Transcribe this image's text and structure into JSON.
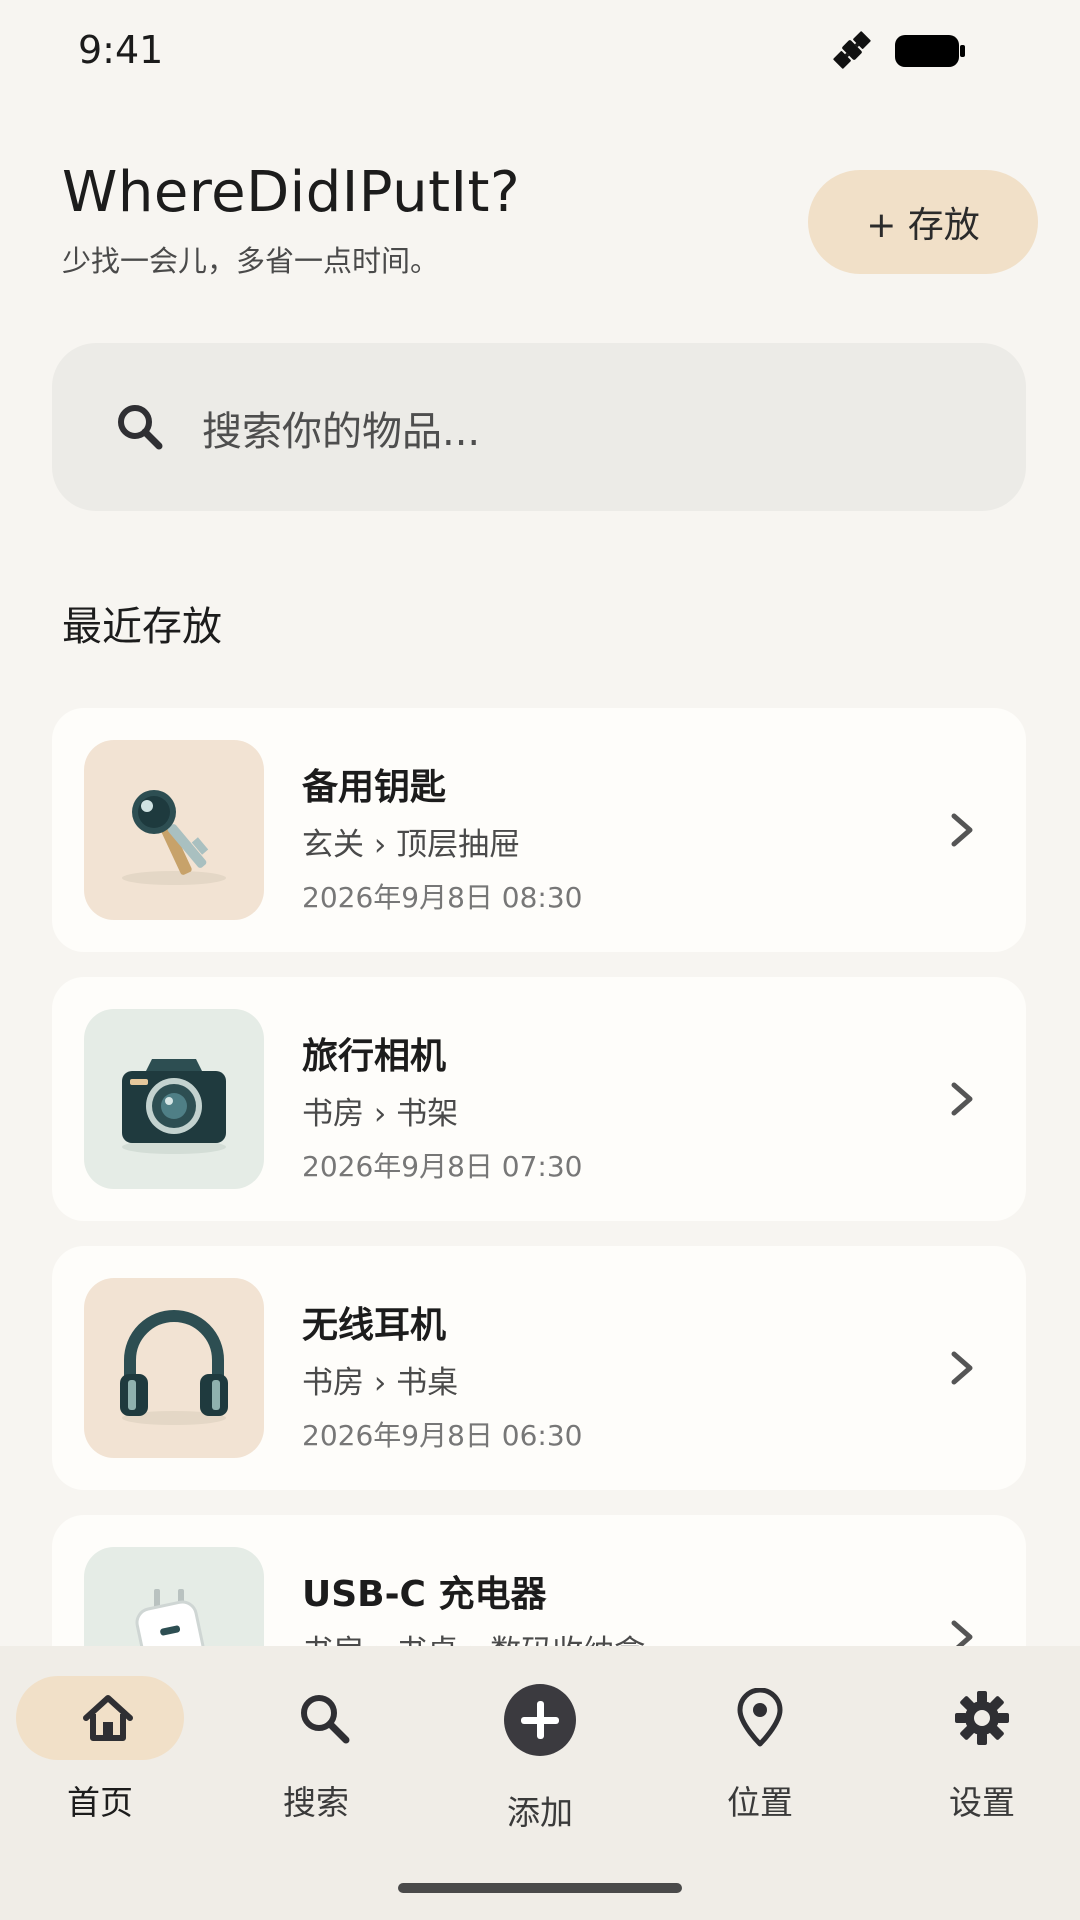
{
  "status_bar": {
    "time": "9:41"
  },
  "header": {
    "title": "WhereDidIPutIt?",
    "subtitle": "少找一会儿，多省一点时间。",
    "store_button_label": "+ 存放"
  },
  "search": {
    "placeholder": "搜索你的物品..."
  },
  "recent": {
    "section_title": "最近存放",
    "items": [
      {
        "name": "备用钥匙",
        "location": "玄关 › 顶层抽屉",
        "date": "2026年9月8日 08:30",
        "icon": "key-icon",
        "thumb_color": "#f2e3d3"
      },
      {
        "name": "旅行相机",
        "location": "书房 › 书架",
        "date": "2026年9月8日 07:30",
        "icon": "camera-icon",
        "thumb_color": "#e5ece6"
      },
      {
        "name": "无线耳机",
        "location": "书房 › 书桌",
        "date": "2026年9月8日 06:30",
        "icon": "headphones-icon",
        "thumb_color": "#f2e3d3"
      },
      {
        "name": "USB-C 充电器",
        "location": "书房 › 书桌 › 数码收纳盒",
        "date": "",
        "icon": "charger-icon",
        "thumb_color": "#e5ece6"
      }
    ]
  },
  "bottom_nav": {
    "items": [
      {
        "label": "首页",
        "icon": "home-icon",
        "active": true
      },
      {
        "label": "搜索",
        "icon": "search-icon",
        "active": false
      },
      {
        "label": "添加",
        "icon": "add-circle-icon",
        "active": false
      },
      {
        "label": "位置",
        "icon": "location-pin-icon",
        "active": false
      },
      {
        "label": "设置",
        "icon": "gear-icon",
        "active": false
      }
    ]
  },
  "colors": {
    "background": "#f7f5f1",
    "accent": "#f1e0c8",
    "card": "#fefdfa",
    "search_bg": "#ecebe7",
    "nav_bg": "#f0ede7",
    "icon_dark": "#3b3a3f",
    "teal": "#2d4e52"
  }
}
